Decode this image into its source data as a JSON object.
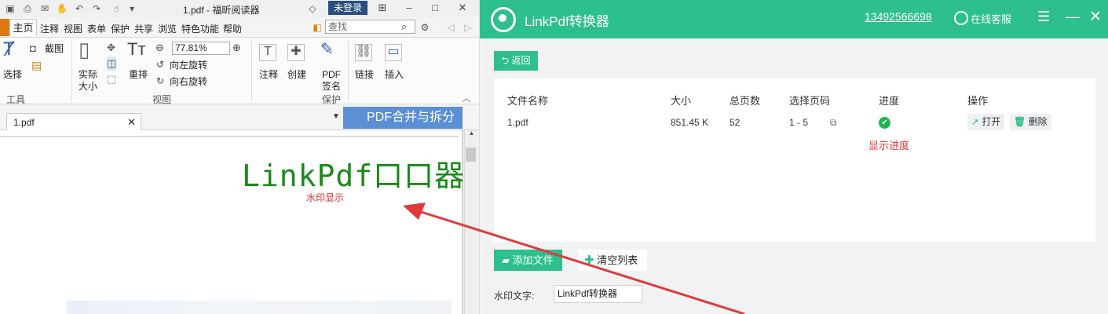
{
  "reader": {
    "doc_title": "1.pdf - 福昕阅读器",
    "login_label": "未登录",
    "menu": [
      "主页",
      "注释",
      "视图",
      "表单",
      "保护",
      "共享",
      "浏览",
      "特色功能",
      "帮助"
    ],
    "search_placeholder": "查找",
    "ribbon": {
      "select_label": "选择",
      "screenshot_label": "截图",
      "tools_group": "工具",
      "actual_size_line1": "实际",
      "actual_size_line2": "大小",
      "reflow_label": "重排",
      "zoom_value": "77.81%",
      "rotate_left": "向左旋转",
      "rotate_right": "向右旋转",
      "view_group": "视图",
      "comment_label": "注释",
      "create_label": "创建",
      "pdf_sign_line1": "PDF",
      "pdf_sign_line2": "签名",
      "protect_group": "保护",
      "link_label": "链接",
      "insert_label": "插入"
    },
    "tab_label": "1.pdf",
    "merge_split_label": "PDF合并与拆分",
    "watermark_text": "LinkPdf口口器",
    "watermark_caption": "水印显示"
  },
  "converter": {
    "app_title": "LinkPdf转换器",
    "phone": "13492566698",
    "support_label": "在线客服",
    "back_label": "返回",
    "columns": [
      "文件名称",
      "大小",
      "总页数",
      "选择页码",
      "进度",
      "操作"
    ],
    "row": {
      "file_name": "1.pdf",
      "size": "851.45 K",
      "pages": "52",
      "page_range": "1 - 5",
      "open_label": "打开",
      "delete_label": "删除"
    },
    "progress_caption": "显示进度",
    "add_file_label": "添加文件",
    "clear_list_label": "清空列表",
    "watermark_label": "水印文字:",
    "watermark_value": "LinkPdf转换器"
  },
  "colors": {
    "brand_green": "#2dbf8c",
    "annotation_red": "#e03a3a",
    "watermark_green": "#1a8a1a",
    "merge_blue": "#5b8fd6"
  }
}
